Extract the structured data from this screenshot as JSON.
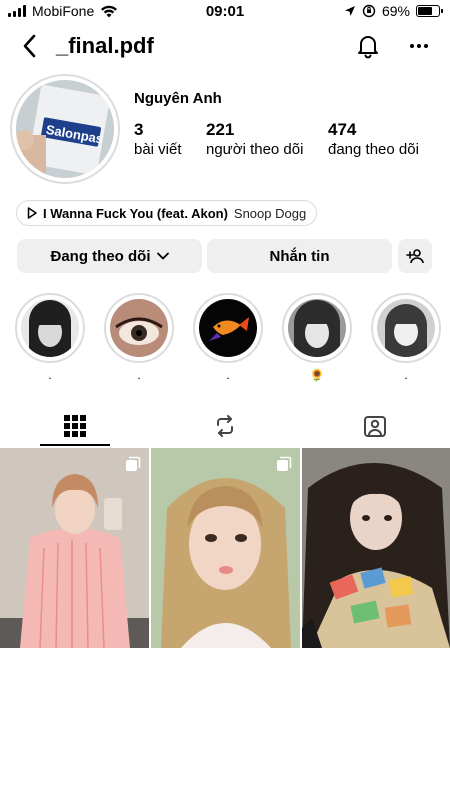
{
  "status_bar": {
    "carrier": "MobiFone",
    "time": "09:01",
    "battery": "69%",
    "battery_level": 0.69
  },
  "header": {
    "username": "_final.pdf"
  },
  "profile": {
    "display_name": "Nguyên Anh",
    "stats": [
      {
        "value": "3",
        "label": "bài viết"
      },
      {
        "value": "221",
        "label": "người theo dõi"
      },
      {
        "value": "474",
        "label": "đang theo dõi"
      }
    ]
  },
  "music": {
    "song": "I Wanna Fuck You (feat. Akon)",
    "artist": "Snoop Dogg"
  },
  "actions": {
    "following_label": "Đang theo dõi",
    "message_label": "Nhắn tin"
  },
  "highlights": [
    {
      "label": "."
    },
    {
      "label": "."
    },
    {
      "label": "."
    },
    {
      "label": "🌻"
    },
    {
      "label": "."
    }
  ],
  "tabs": [
    {
      "icon": "grid-icon",
      "active": true
    },
    {
      "icon": "reels-repost-icon",
      "active": false
    },
    {
      "icon": "tagged-icon",
      "active": false
    }
  ],
  "posts": [
    {
      "kind": "carousel"
    },
    {
      "kind": "carousel"
    },
    {
      "kind": "single"
    }
  ],
  "colors": {
    "button_bg": "#efefef",
    "ring_border": "#dcdcdc",
    "text": "#000000"
  }
}
